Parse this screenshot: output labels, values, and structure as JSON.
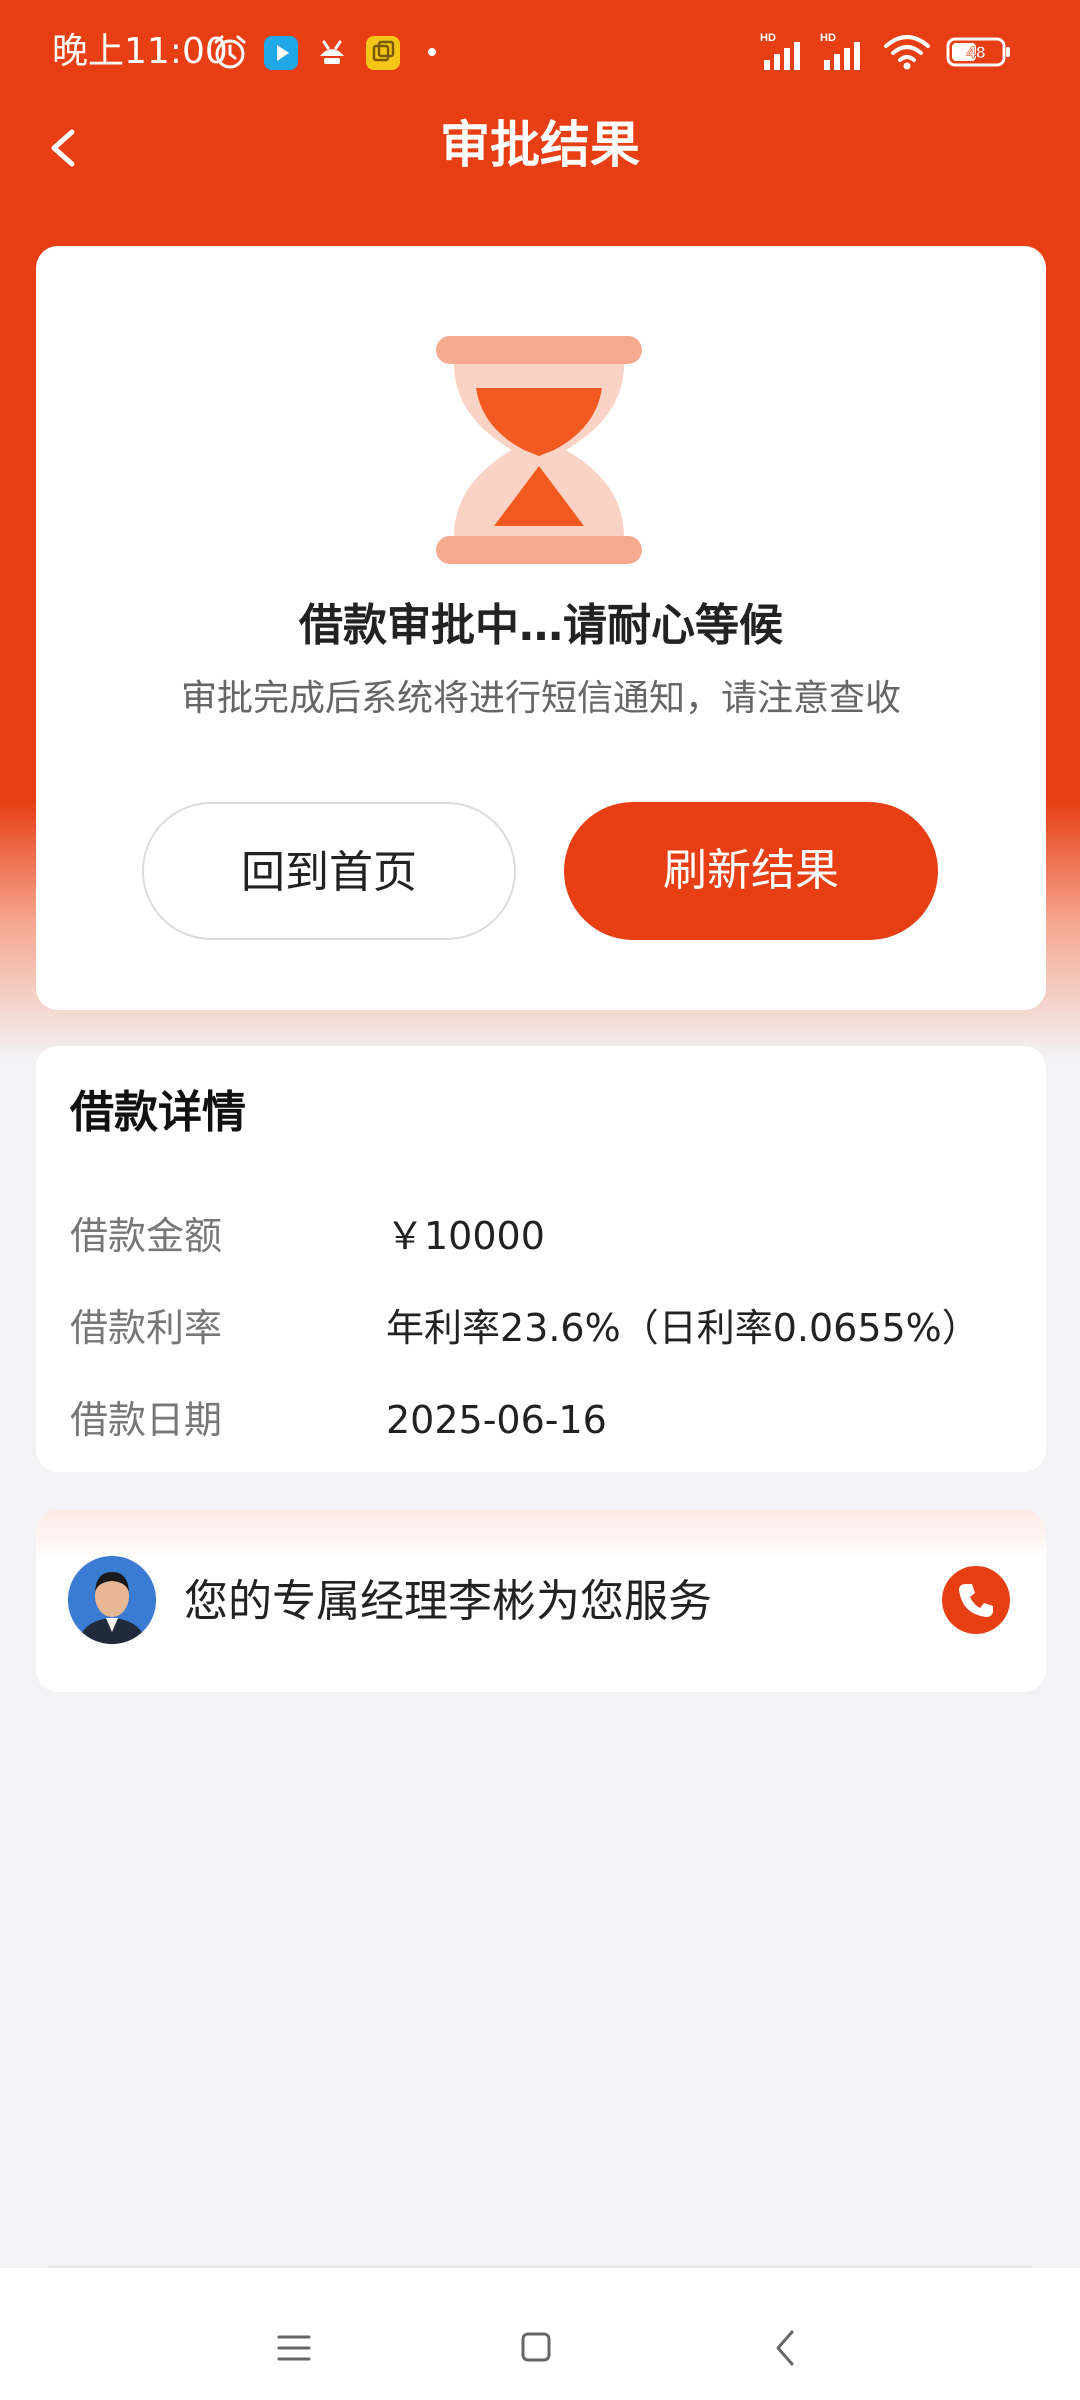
{
  "status_bar": {
    "time": "晚上11:00",
    "signal_label": "HD",
    "battery": "48"
  },
  "header": {
    "title": "审批结果"
  },
  "status_card": {
    "title": "借款审批中…请耐心等候",
    "description": "审批完成后系统将进行短信通知，请注意查收",
    "home_button": "回到首页",
    "refresh_button": "刷新结果"
  },
  "details": {
    "title": "借款详情",
    "rows": [
      {
        "label": "借款金额",
        "value": "￥10000"
      },
      {
        "label": "借款利率",
        "value": "年利率23.6%（日利率0.0655%）"
      },
      {
        "label": "借款日期",
        "value": "2025-06-16"
      }
    ]
  },
  "manager": {
    "text": "您的专属经理李彬为您服务"
  },
  "colors": {
    "brand": "#e73e14",
    "background": "#f3f3f5",
    "card": "#ffffff"
  },
  "icons": {
    "back": "chevron-left-icon",
    "status": "hourglass-icon",
    "phone": "phone-icon",
    "nav": [
      "menu-icon",
      "home-icon",
      "back-icon"
    ]
  }
}
